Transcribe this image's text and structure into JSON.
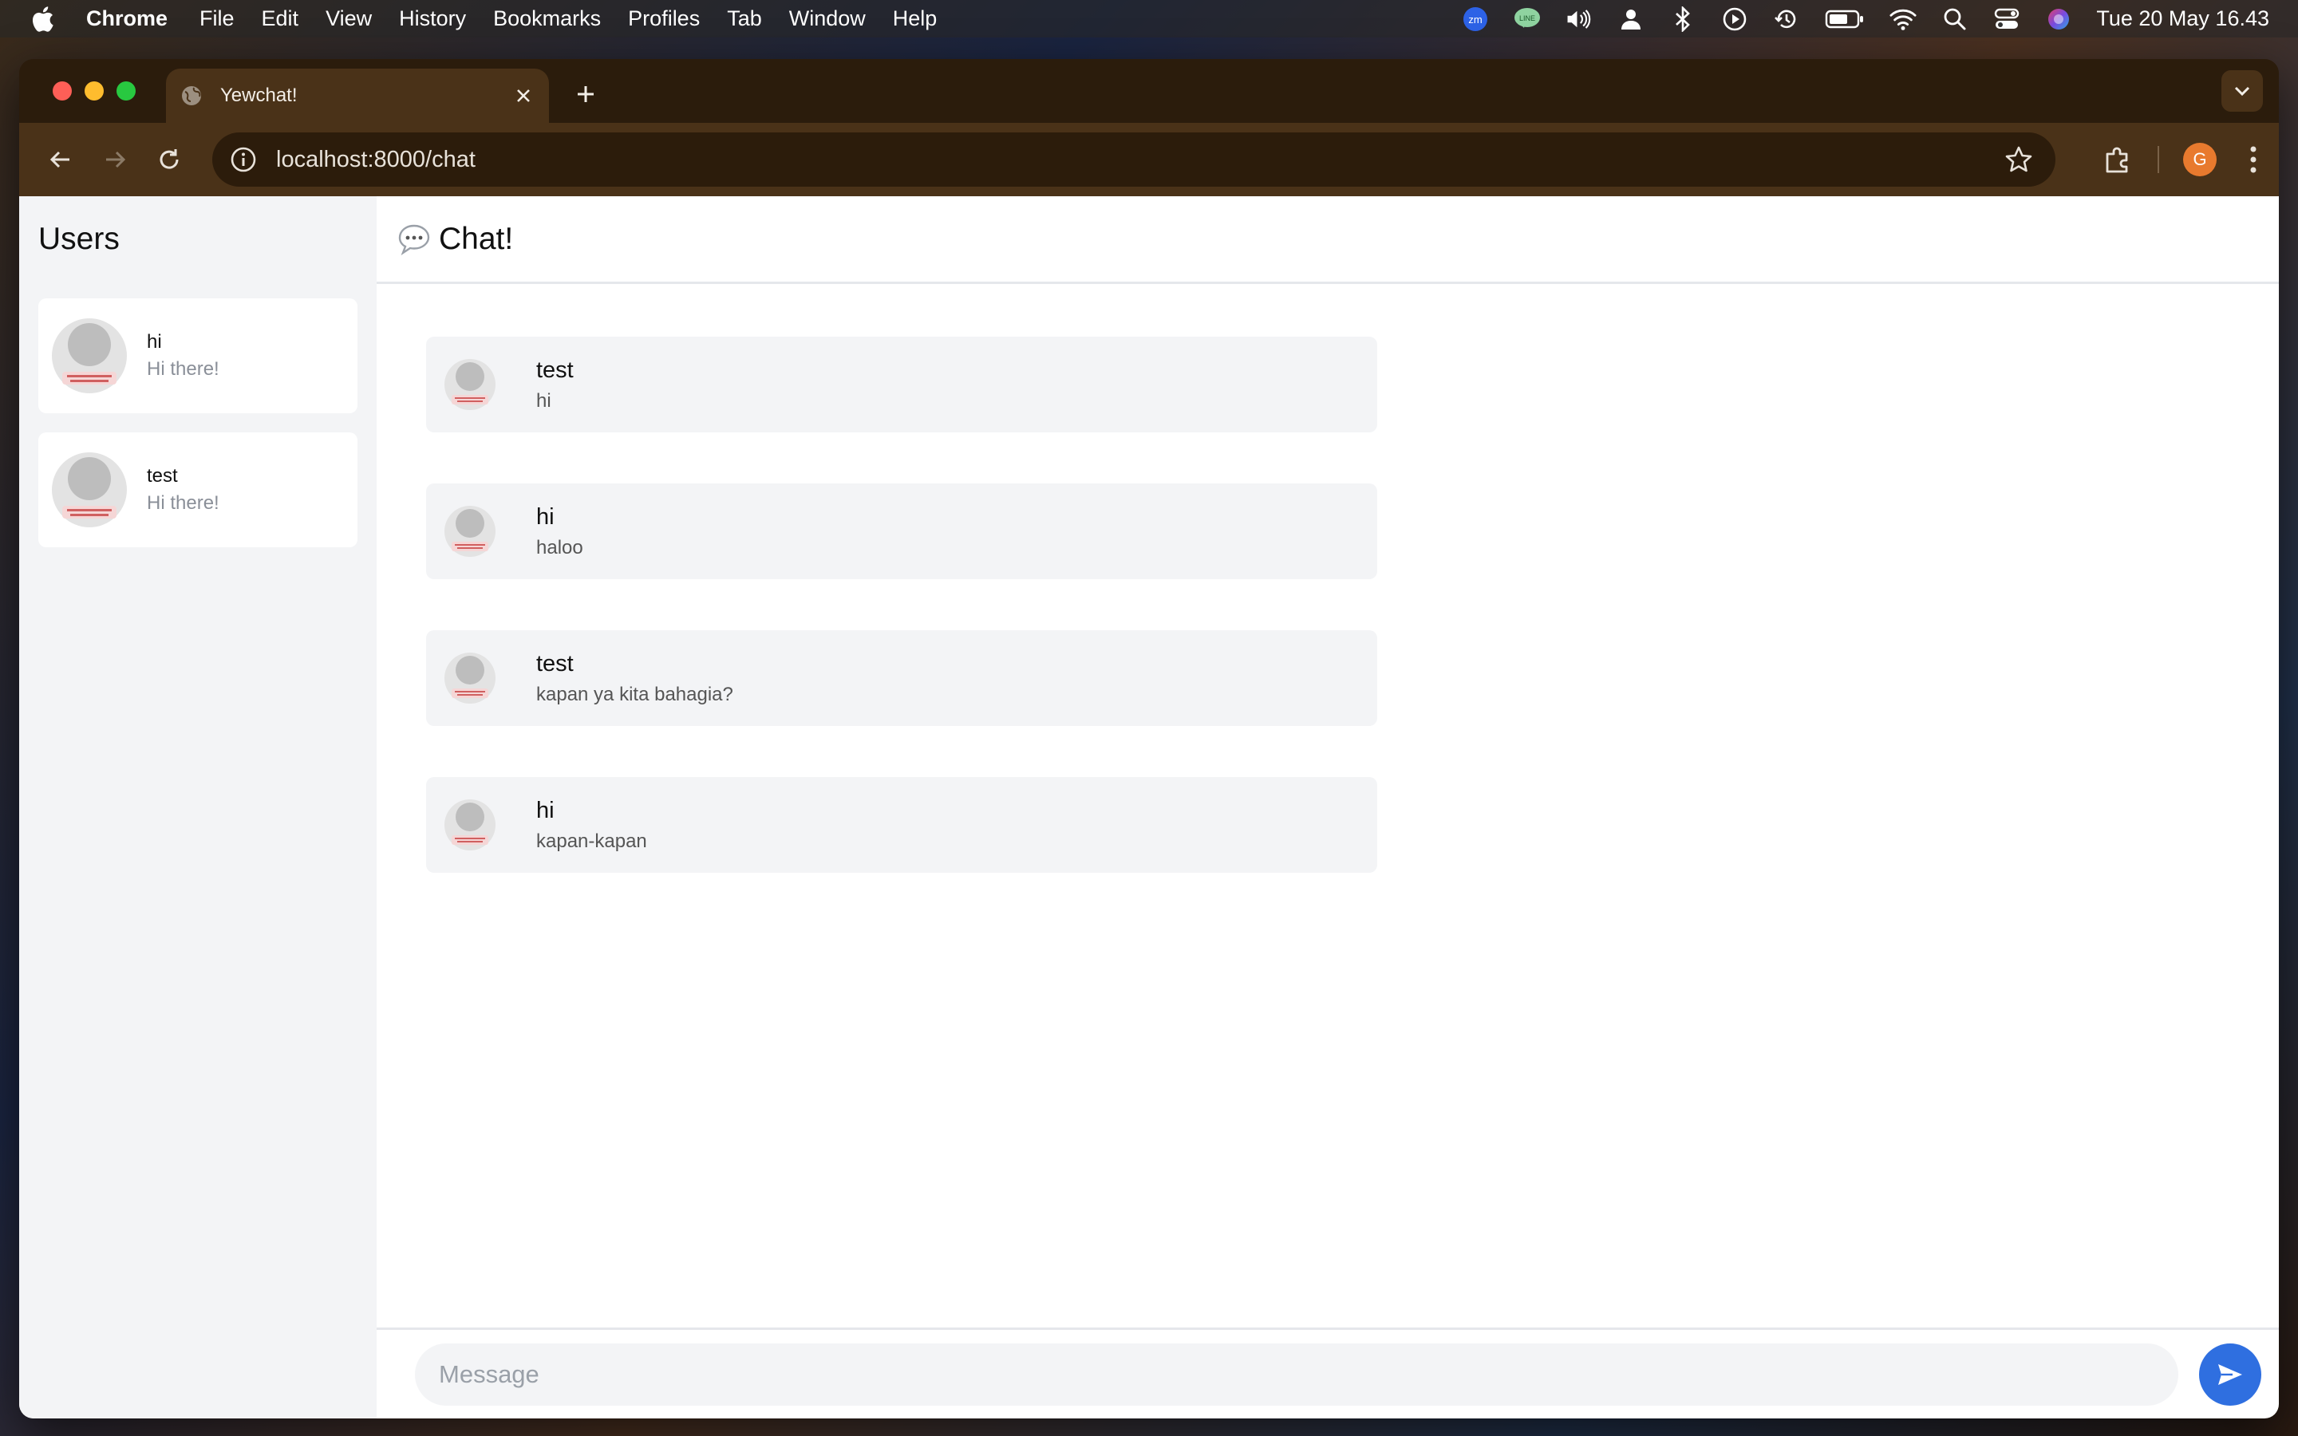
{
  "menubar": {
    "app_name": "Chrome",
    "items": [
      "File",
      "Edit",
      "View",
      "History",
      "Bookmarks",
      "Profiles",
      "Tab",
      "Window",
      "Help"
    ],
    "status_icons": [
      "zoom-icon",
      "line-icon",
      "volume-icon",
      "user-icon",
      "bluetooth-icon",
      "play-icon",
      "time-machine-icon",
      "battery-icon",
      "wifi-icon",
      "search-icon",
      "control-center-icon",
      "siri-icon"
    ],
    "clock": "Tue 20 May  16.43"
  },
  "browser": {
    "tab_title": "Yewchat!",
    "url": "localhost:8000/chat",
    "profile_initial": "G",
    "colors": {
      "frame": "#2b1c0c",
      "toolbar": "#4a3218",
      "omnibox": "#2c1c0b",
      "profile": "#e87a2e"
    }
  },
  "sidebar": {
    "title": "Users",
    "users": [
      {
        "name": "hi",
        "status": "Hi there!"
      },
      {
        "name": "test",
        "status": "Hi there!"
      }
    ]
  },
  "chat": {
    "header_icon": "speech-bubble-icon",
    "title": "Chat!",
    "messages": [
      {
        "from": "test",
        "text": "hi"
      },
      {
        "from": "hi",
        "text": "haloo"
      },
      {
        "from": "test",
        "text": "kapan ya kita bahagia?"
      },
      {
        "from": "hi",
        "text": "kapan-kapan"
      }
    ],
    "composer": {
      "placeholder": "Message",
      "value": ""
    },
    "accent": "#2f6fe0"
  }
}
